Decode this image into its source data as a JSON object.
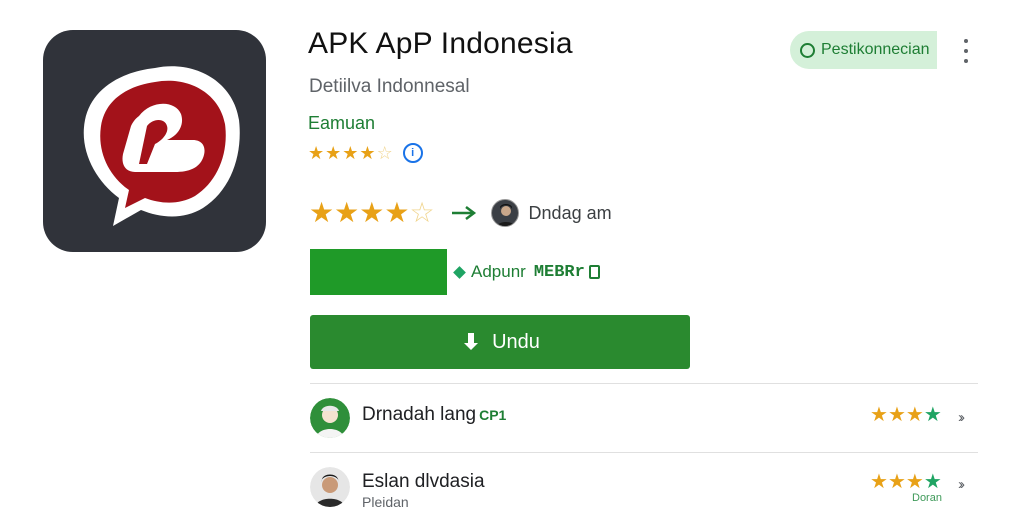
{
  "app": {
    "icon_name": "app-logo-icon",
    "title": "APK ApP Indonesia",
    "subtitle": "Detiilva Indonnesal",
    "developer": "Eamuan",
    "rating_small": 3.5
  },
  "header": {
    "status_label": "Pestikonnecian",
    "more_icon": "more-vertical-icon"
  },
  "rating_row": {
    "stars": 4,
    "reviewer_name": "Dndag am"
  },
  "badges": {
    "label": "Adpunr",
    "code": "MEBRr"
  },
  "download": {
    "label": "Undu"
  },
  "reviews": [
    {
      "name": "Drnadah lang",
      "tag": "CP1",
      "stars": 4
    },
    {
      "name": "Eslan dlvdasia",
      "sub": "Pleidan",
      "stars": 3.5,
      "caption": "Doran"
    }
  ],
  "colors": {
    "accent_green": "#2a8a2f",
    "star_gold": "#e8a117",
    "star_green": "#1fa463",
    "icon_bg": "#30333a",
    "logo_red": "#a3121a"
  }
}
